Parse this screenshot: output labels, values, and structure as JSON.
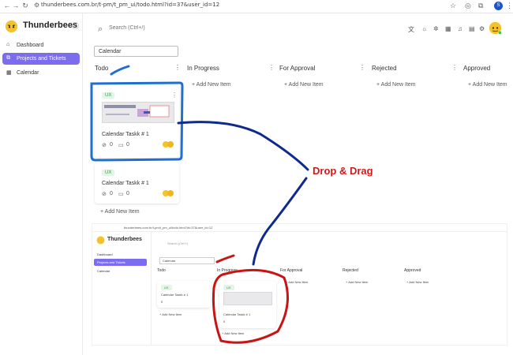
{
  "browser": {
    "url": "thunderbees.com.br/t-pm/t_pm_ui/todo.html?id=37&user_id=12",
    "profile_initial": "S"
  },
  "sidebar": {
    "brand": "Thunderbees",
    "items": [
      {
        "label": "Dashboard",
        "icon": "home-icon",
        "active": false
      },
      {
        "label": "Projects and Tickets",
        "icon": "projects-icon",
        "active": true
      },
      {
        "label": "Calendar",
        "icon": "calendar-icon",
        "active": false
      }
    ]
  },
  "header": {
    "search_placeholder": "Search (Ctrl+/)"
  },
  "filter": {
    "value": "Calendar"
  },
  "columns": [
    {
      "title": "Todo",
      "add_label": "+ Add New Item"
    },
    {
      "title": "In Progress",
      "add_label": "+ Add New Item"
    },
    {
      "title": "For Approval",
      "add_label": "+ Add New Item"
    },
    {
      "title": "Rejected",
      "add_label": "+ Add New Item"
    },
    {
      "title": "Approved",
      "add_label": "+ Add New Item"
    }
  ],
  "cards": [
    {
      "tag": "UX",
      "title": "Calendar Taskk # 1",
      "attachments": "0",
      "comments": "0"
    },
    {
      "tag": "UX",
      "title": "Calendar Taskk # 1",
      "attachments": "0",
      "comments": "0"
    }
  ],
  "todo_add_label": "+ Add New Item",
  "annotation": {
    "text": "Drop & Drag",
    "color": "#d01a1a"
  },
  "inner": {
    "url": "thunderbees.com.br/t-pm/t_pm_ui/todo.html?id=37&user_id=12",
    "brand": "Thunderbees",
    "search_placeholder": "Search (Ctrl+/)",
    "filter": "Calendar",
    "side_items": [
      "Dashboard",
      "Projects and Tickets",
      "Calendar"
    ],
    "columns": [
      "Todo",
      "In Progress",
      "For Approval",
      "Rejected",
      "Approved"
    ],
    "add_label": "+ Add New Item",
    "card_tag": "UX",
    "card_title": "Calendar Taskk # 1",
    "card_counts": "0"
  },
  "colors": {
    "accent": "#7b6cf0",
    "blue_highlight": "#1f6fd1",
    "red_highlight": "#c81414"
  }
}
